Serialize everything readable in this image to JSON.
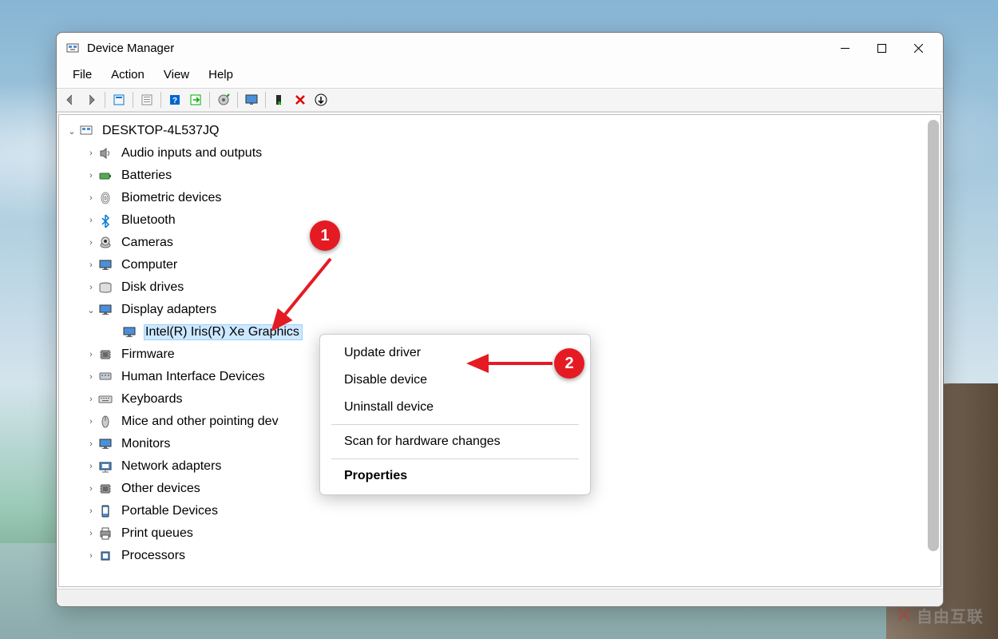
{
  "window": {
    "title": "Device Manager"
  },
  "menubar": [
    "File",
    "Action",
    "View",
    "Help"
  ],
  "tree": {
    "root": "DESKTOP-4L537JQ",
    "nodes": [
      {
        "label": "Audio inputs and outputs",
        "icon": "speaker"
      },
      {
        "label": "Batteries",
        "icon": "battery"
      },
      {
        "label": "Biometric devices",
        "icon": "fingerprint"
      },
      {
        "label": "Bluetooth",
        "icon": "bluetooth"
      },
      {
        "label": "Cameras",
        "icon": "camera"
      },
      {
        "label": "Computer",
        "icon": "monitor"
      },
      {
        "label": "Disk drives",
        "icon": "disk"
      },
      {
        "label": "Display adapters",
        "icon": "monitor",
        "expanded": true,
        "children": [
          {
            "label": "Intel(R) Iris(R) Xe Graphics",
            "icon": "monitor",
            "selected": true
          }
        ]
      },
      {
        "label": "Firmware",
        "icon": "chip"
      },
      {
        "label": "Human Interface Devices",
        "icon": "hid"
      },
      {
        "label": "Keyboards",
        "icon": "keyboard"
      },
      {
        "label": "Mice and other pointing dev",
        "icon": "mouse"
      },
      {
        "label": "Monitors",
        "icon": "monitor"
      },
      {
        "label": "Network adapters",
        "icon": "network"
      },
      {
        "label": "Other devices",
        "icon": "chip"
      },
      {
        "label": "Portable Devices",
        "icon": "portable"
      },
      {
        "label": "Print queues",
        "icon": "printer"
      },
      {
        "label": "Processors",
        "icon": "cpu"
      }
    ]
  },
  "context_menu": [
    {
      "label": "Update driver",
      "type": "item"
    },
    {
      "label": "Disable device",
      "type": "item"
    },
    {
      "label": "Uninstall device",
      "type": "item"
    },
    {
      "type": "sep"
    },
    {
      "label": "Scan for hardware changes",
      "type": "item"
    },
    {
      "type": "sep"
    },
    {
      "label": "Properties",
      "type": "item",
      "bold": true
    }
  ],
  "annotations": {
    "marker1": "1",
    "marker2": "2"
  },
  "watermark": "自由互联"
}
